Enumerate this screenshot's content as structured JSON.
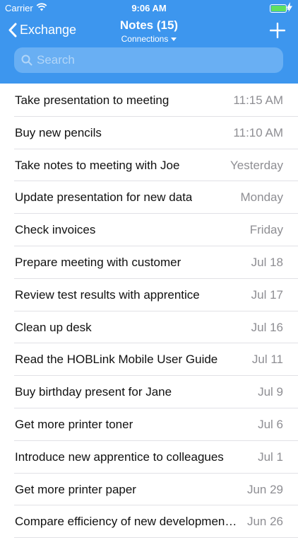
{
  "status_bar": {
    "carrier": "Carrier",
    "time": "9:06 AM",
    "battery_level": 0.95,
    "battery_color": "#5fe05f"
  },
  "nav": {
    "back_label": "Exchange",
    "title": "Notes (15)",
    "subtitle": "Connections",
    "accent_color": "#3d96ee"
  },
  "search": {
    "placeholder": "Search"
  },
  "notes": [
    {
      "title": "Take presentation to meeting",
      "date": "11:15 AM"
    },
    {
      "title": "Buy new pencils",
      "date": "11:10 AM"
    },
    {
      "title": "Take notes to meeting with Joe",
      "date": "Yesterday"
    },
    {
      "title": "Update presentation for new data",
      "date": "Monday"
    },
    {
      "title": "Check invoices",
      "date": "Friday"
    },
    {
      "title": "Prepare meeting with customer",
      "date": "Jul 18"
    },
    {
      "title": "Review test results with apprentice",
      "date": "Jul 17"
    },
    {
      "title": "Clean up desk",
      "date": "Jul 16"
    },
    {
      "title": "Read the HOBLink Mobile User Guide",
      "date": "Jul 11"
    },
    {
      "title": "Buy birthday present for Jane",
      "date": "Jul 9"
    },
    {
      "title": "Get more printer toner",
      "date": "Jul 6"
    },
    {
      "title": "Introduce new apprentice to colleagues",
      "date": "Jul 1"
    },
    {
      "title": "Get more printer paper",
      "date": "Jun 29"
    },
    {
      "title": "Compare efficiency of new development tools",
      "date": "Jun 26"
    }
  ]
}
